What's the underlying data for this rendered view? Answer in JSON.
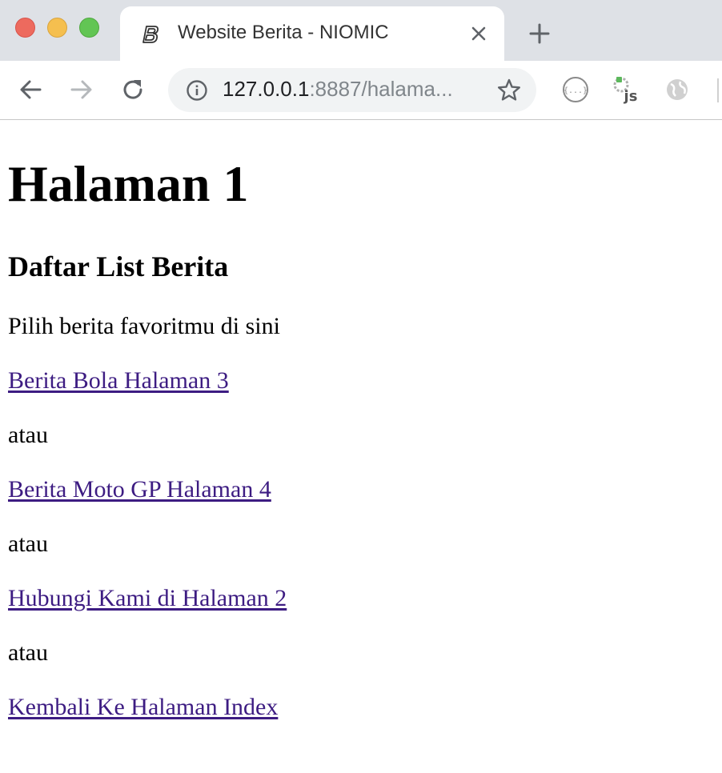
{
  "browser": {
    "tab": {
      "title": "Website Berita - NIOMIC",
      "favicon": "bold-b-icon"
    },
    "address_bar": {
      "host": "127.0.0.1",
      "rest": ":8887/halama..."
    },
    "toolbar_icons": [
      "back-arrow-icon",
      "forward-arrow-icon",
      "reload-icon",
      "info-icon",
      "star-icon",
      "json-viewer-extension-icon",
      "js-extension-icon",
      "globe-extension-icon"
    ],
    "colors": {
      "tabstrip": "#dee1e6",
      "close": "#ed6a5e",
      "minimize": "#f5bf4f",
      "maximize": "#62c554",
      "link": "#3d1c82"
    }
  },
  "page": {
    "heading": "Halaman 1",
    "subheading": "Daftar List Berita",
    "intro": "Pilih berita favoritmu di sini",
    "links": [
      "Berita Bola Halaman 3",
      "Berita Moto GP Halaman 4",
      "Hubungi Kami di Halaman 2",
      "Kembali Ke Halaman Index"
    ],
    "separator": "atau"
  }
}
